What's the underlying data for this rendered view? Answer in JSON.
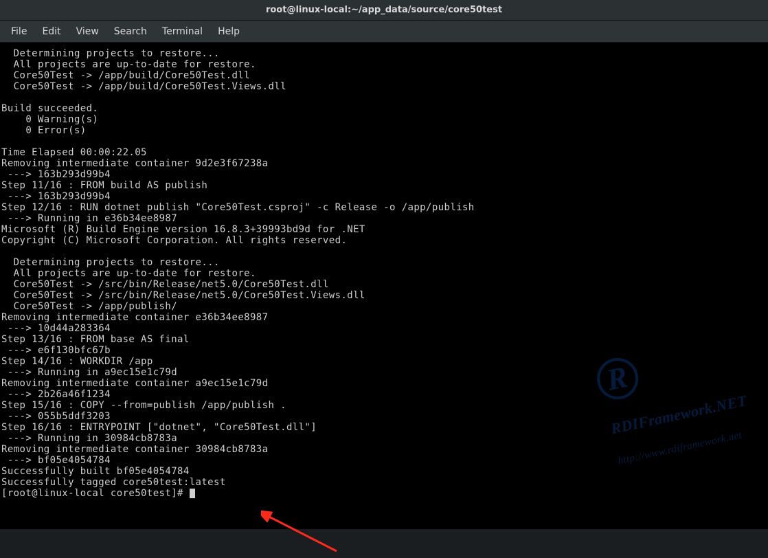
{
  "title": "root@linux-local:~/app_data/source/core50test",
  "menu": {
    "file": "File",
    "edit": "Edit",
    "view": "View",
    "search": "Search",
    "terminal": "Terminal",
    "help": "Help"
  },
  "terminal_lines": [
    "  Determining projects to restore...",
    "  All projects are up-to-date for restore.",
    "  Core50Test -> /app/build/Core50Test.dll",
    "  Core50Test -> /app/build/Core50Test.Views.dll",
    "",
    "Build succeeded.",
    "    0 Warning(s)",
    "    0 Error(s)",
    "",
    "Time Elapsed 00:00:22.05",
    "Removing intermediate container 9d2e3f67238a",
    " ---> 163b293d99b4",
    "Step 11/16 : FROM build AS publish",
    " ---> 163b293d99b4",
    "Step 12/16 : RUN dotnet publish \"Core50Test.csproj\" -c Release -o /app/publish",
    " ---> Running in e36b34ee8987",
    "Microsoft (R) Build Engine version 16.8.3+39993bd9d for .NET",
    "Copyright (C) Microsoft Corporation. All rights reserved.",
    "",
    "  Determining projects to restore...",
    "  All projects are up-to-date for restore.",
    "  Core50Test -> /src/bin/Release/net5.0/Core50Test.dll",
    "  Core50Test -> /src/bin/Release/net5.0/Core50Test.Views.dll",
    "  Core50Test -> /app/publish/",
    "Removing intermediate container e36b34ee8987",
    " ---> 10d44a283364",
    "Step 13/16 : FROM base AS final",
    " ---> e6f130bfc67b",
    "Step 14/16 : WORKDIR /app",
    " ---> Running in a9ec15e1c79d",
    "Removing intermediate container a9ec15e1c79d",
    " ---> 2b26a46f1234",
    "Step 15/16 : COPY --from=publish /app/publish .",
    " ---> 055b5ddf3203",
    "Step 16/16 : ENTRYPOINT [\"dotnet\", \"Core50Test.dll\"]",
    " ---> Running in 30984cb8783a",
    "Removing intermediate container 30984cb8783a",
    " ---> bf05e4054784",
    "Successfully built bf05e4054784",
    "Successfully tagged core50test:latest"
  ],
  "prompt": "[root@linux-local core50test]# ",
  "watermark": {
    "logo_letter": "R",
    "line1": "RDIFramework.NET",
    "line2": "http://www.rdiframework.net"
  }
}
